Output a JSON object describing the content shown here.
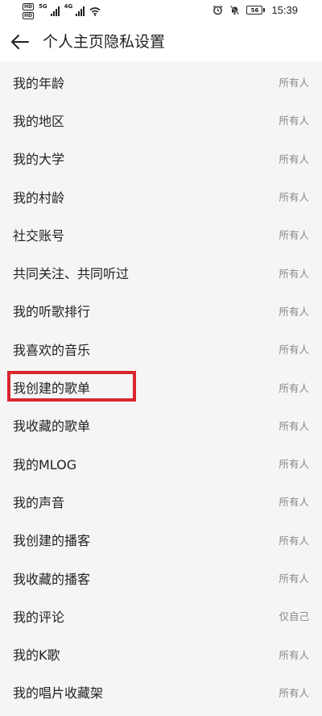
{
  "status_bar": {
    "hd1": "HD",
    "hd2": "HD",
    "net1": "5G",
    "net2": "4G",
    "battery": "56",
    "time": "15:39"
  },
  "header": {
    "title": "个人主页隐私设置"
  },
  "settings": [
    {
      "label": "我的年龄",
      "value": "所有人"
    },
    {
      "label": "我的地区",
      "value": "所有人"
    },
    {
      "label": "我的大学",
      "value": "所有人"
    },
    {
      "label": "我的村龄",
      "value": "所有人"
    },
    {
      "label": "社交账号",
      "value": "所有人"
    },
    {
      "label": "共同关注、共同听过",
      "value": "所有人"
    },
    {
      "label": "我的听歌排行",
      "value": "所有人"
    },
    {
      "label": "我喜欢的音乐",
      "value": "所有人"
    },
    {
      "label": "我创建的歌单",
      "value": "所有人"
    },
    {
      "label": "我收藏的歌单",
      "value": "所有人"
    },
    {
      "label": "我的MLOG",
      "value": "所有人"
    },
    {
      "label": "我的声音",
      "value": "所有人"
    },
    {
      "label": "我创建的播客",
      "value": "所有人"
    },
    {
      "label": "我收藏的播客",
      "value": "所有人"
    },
    {
      "label": "我的评论",
      "value": "仅自己"
    },
    {
      "label": "我的K歌",
      "value": "所有人"
    },
    {
      "label": "我的唱片收藏架",
      "value": "所有人"
    }
  ],
  "highlight": {
    "color": "#d9262e",
    "target": "我创建的歌单"
  }
}
